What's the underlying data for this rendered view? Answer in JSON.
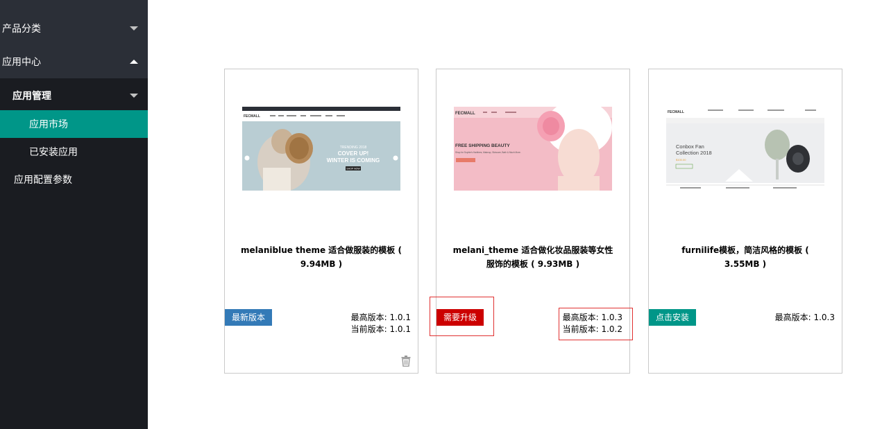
{
  "sidebar": {
    "product_category": "产品分类",
    "app_center": "应用中心",
    "app_management": "应用管理",
    "app_market": "应用市场",
    "installed_apps": "已安装应用",
    "app_config": "应用配置参数"
  },
  "cards": [
    {
      "title": "melaniblue theme 适合做服装的模板 ( 9.94MB )",
      "button": "最新版本",
      "button_color": "#337ab7",
      "highest_version": "最高版本: 1.0.1",
      "current_version": "当前版本: 1.0.1",
      "thumb": {
        "logo": "FECMALL",
        "eyebrow": "TRENDING 2018",
        "headline1": "COVER UP!",
        "headline2": "WINTER IS COMING",
        "cta": "SHOP NOW"
      }
    },
    {
      "title": "melani_theme 适合做化妆品服装等女性服饰的模板 ( 9.93MB )",
      "button": "需要升级",
      "button_color": "#cc0000",
      "highest_version": "最高版本: 1.0.3",
      "current_version": "当前版本: 1.0.2",
      "thumb": {
        "logo": "FECMALL",
        "headline": "FREE SHIPPING BEAUTY",
        "sub": "Shop for Sophie's Hairlines, Makeup, Skincare, Bath & Much More."
      }
    },
    {
      "title": "furnilife模板，简洁风格的模板 ( 3.55MB )",
      "button": "点击安装",
      "button_color": "#009688",
      "highest_version": "最高版本: 1.0.3",
      "thumb": {
        "logo": "FECMALL",
        "headline1": "Conbox Fan",
        "headline2": "Collection 2018",
        "price": "$100.00"
      }
    }
  ]
}
